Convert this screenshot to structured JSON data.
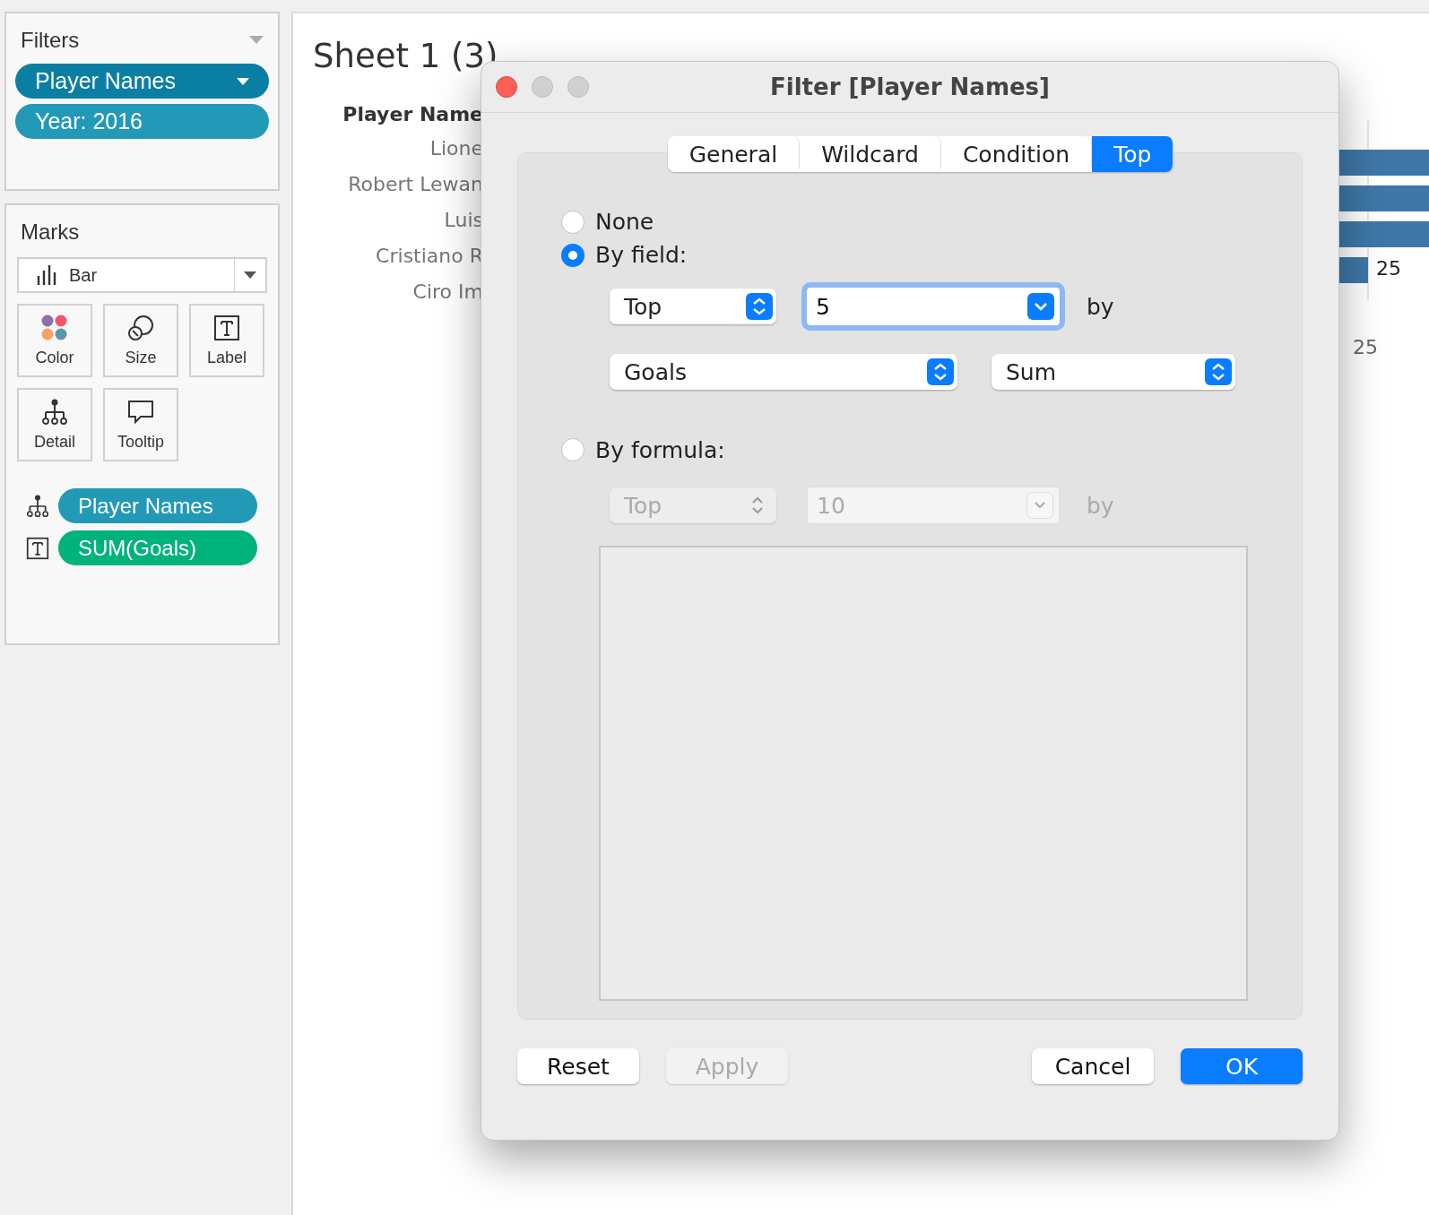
{
  "filters": {
    "title": "Filters",
    "pills": [
      {
        "label": "Player Names",
        "color": "#0b7fa3",
        "menu": true
      },
      {
        "label": "Year: 2016",
        "color": "#2399b8",
        "menu": false
      }
    ]
  },
  "marks": {
    "title": "Marks",
    "mark_type": "Bar",
    "cards": [
      {
        "kind": "color",
        "label": "Color"
      },
      {
        "kind": "size",
        "label": "Size"
      },
      {
        "kind": "label",
        "label": "Label"
      },
      {
        "kind": "detail",
        "label": "Detail"
      },
      {
        "kind": "tooltip",
        "label": "Tooltip"
      }
    ],
    "shelf": [
      {
        "kind": "detail",
        "label": "Player Names",
        "color": "#2399b8"
      },
      {
        "kind": "label",
        "label": "SUM(Goals)",
        "color": "#00b37a"
      }
    ]
  },
  "sheet": {
    "title": "Sheet 1 (3)",
    "header": "Player Name",
    "rows": [
      "Lione",
      "Robert Lewan",
      "Luis",
      "Cristiano R",
      "Ciro Im"
    ],
    "bar_label": "25",
    "axis_tick": "25"
  },
  "dialog": {
    "title": "Filter [Player Names]",
    "tabs": [
      {
        "label": "General",
        "selected": false
      },
      {
        "label": "Wildcard",
        "selected": false
      },
      {
        "label": "Condition",
        "selected": false
      },
      {
        "label": "Top",
        "selected": true
      }
    ],
    "options": [
      {
        "label": "None",
        "selected": false
      },
      {
        "label": "By field:",
        "selected": true
      },
      {
        "label": "By formula:",
        "selected": false
      }
    ],
    "by_field": {
      "direction": "Top",
      "count": "5",
      "by": "by",
      "field": "Goals",
      "aggregation": "Sum"
    },
    "by_formula": {
      "direction": "Top",
      "count": "10",
      "by": "by",
      "disabled": true
    },
    "buttons": [
      {
        "label": "Reset",
        "kind": "default",
        "disabled": false
      },
      {
        "label": "Apply",
        "kind": "default",
        "disabled": true
      },
      {
        "label": "Cancel",
        "kind": "default",
        "disabled": false
      },
      {
        "label": "OK",
        "kind": "primary",
        "disabled": false
      }
    ]
  }
}
